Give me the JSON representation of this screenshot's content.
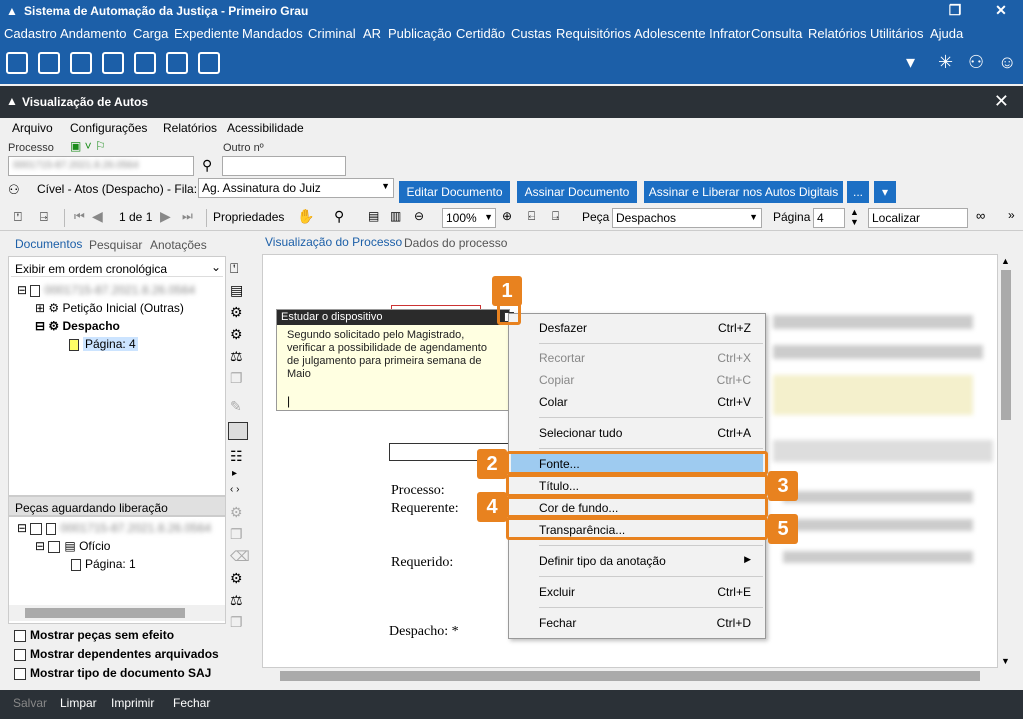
{
  "window": {
    "title": "Sistema de Automação da Justiça - Primeiro Grau"
  },
  "menu": [
    "Cadastro",
    "Andamento",
    "Carga",
    "Expediente",
    "Mandados",
    "Criminal",
    "AR",
    "Publicação",
    "Certidão",
    "Custas",
    "Requisitórios",
    "Adolescente Infrator",
    "Consulta",
    "Relatórios",
    "Utilitários",
    "Ajuda"
  ],
  "subwindow": {
    "title": "Visualização de Autos"
  },
  "submenu": [
    "Arquivo",
    "Configurações",
    "Relatórios",
    "Acessibilidade"
  ],
  "fields": {
    "processo_label": "Processo",
    "processo_value": "0001715-87.2021.8.26.0564",
    "outro_label": "Outro nº",
    "fila_text": "Cível - Atos (Despacho) - Fila:",
    "fila_value": "Ag. Assinatura do Juiz"
  },
  "buttons": {
    "editar": "Editar Documento",
    "assinar": "Assinar Documento",
    "assinar_liberar": "Assinar e Liberar nos Autos Digitais",
    "more": "..."
  },
  "toolbar": {
    "page_of": "1 de 1",
    "propriedades": "Propriedades",
    "zoom": "100%",
    "peca_label": "Peça",
    "peca_value": "Despachos",
    "pagina_label": "Página",
    "pagina_value": "4",
    "localizar": "Localizar"
  },
  "left_tabs": [
    "Documentos",
    "Pesquisar",
    "Anotações"
  ],
  "right_tabs": [
    "Visualização do Processo",
    "Dados do processo"
  ],
  "order": "Exibir em ordem cronológica",
  "tree": {
    "root": "0001715-87.2021.8.26.0564",
    "peticao": "Petição Inicial (Outras)",
    "despacho": "Despacho",
    "pagina": "Página: 4"
  },
  "pending": {
    "title": "Peças aguardando liberação",
    "root": "0001715-87.2021.8.26.0564",
    "oficio": "Ofício",
    "pagina": "Página: 1"
  },
  "checks": [
    "Mostrar peças sem efeito",
    "Mostrar dependentes arquivados",
    "Mostrar tipo de documento SAJ"
  ],
  "note": {
    "title": "Estudar o dispositivo",
    "text": "Segundo solicitado pelo Magistrado, verificar a possibilidade de agendamento de julgamento para primeira semana de Maio"
  },
  "document": {
    "processo": "Processo:",
    "requerente": "Requerente:",
    "requerido": "Requerido:",
    "despacho": "Despacho: *"
  },
  "context_menu": [
    {
      "label": "Desfazer",
      "shortcut": "Ctrl+Z",
      "disabled": false
    },
    {
      "label": "Recortar",
      "shortcut": "Ctrl+X",
      "disabled": true
    },
    {
      "label": "Copiar",
      "shortcut": "Ctrl+C",
      "disabled": true
    },
    {
      "label": "Colar",
      "shortcut": "Ctrl+V",
      "disabled": false
    },
    {
      "label": "Selecionar tudo",
      "shortcut": "Ctrl+A",
      "disabled": false
    },
    {
      "label": "Fonte...",
      "shortcut": "",
      "disabled": false
    },
    {
      "label": "Título...",
      "shortcut": "",
      "disabled": false
    },
    {
      "label": "Cor de fundo...",
      "shortcut": "",
      "disabled": false
    },
    {
      "label": "Transparência...",
      "shortcut": "",
      "disabled": false
    },
    {
      "label": "Definir tipo da anotação",
      "shortcut": "",
      "disabled": false
    },
    {
      "label": "Excluir",
      "shortcut": "Ctrl+E",
      "disabled": false
    },
    {
      "label": "Fechar",
      "shortcut": "Ctrl+D",
      "disabled": false
    }
  ],
  "badges": [
    "1",
    "2",
    "3",
    "4",
    "5"
  ],
  "status": [
    "Salvar",
    "Limpar",
    "Imprimir",
    "Fechar"
  ],
  "colors": {
    "brand": "#1c5fa8",
    "highlight": "#e8821f",
    "menu_hover": "#9ecbf0"
  }
}
